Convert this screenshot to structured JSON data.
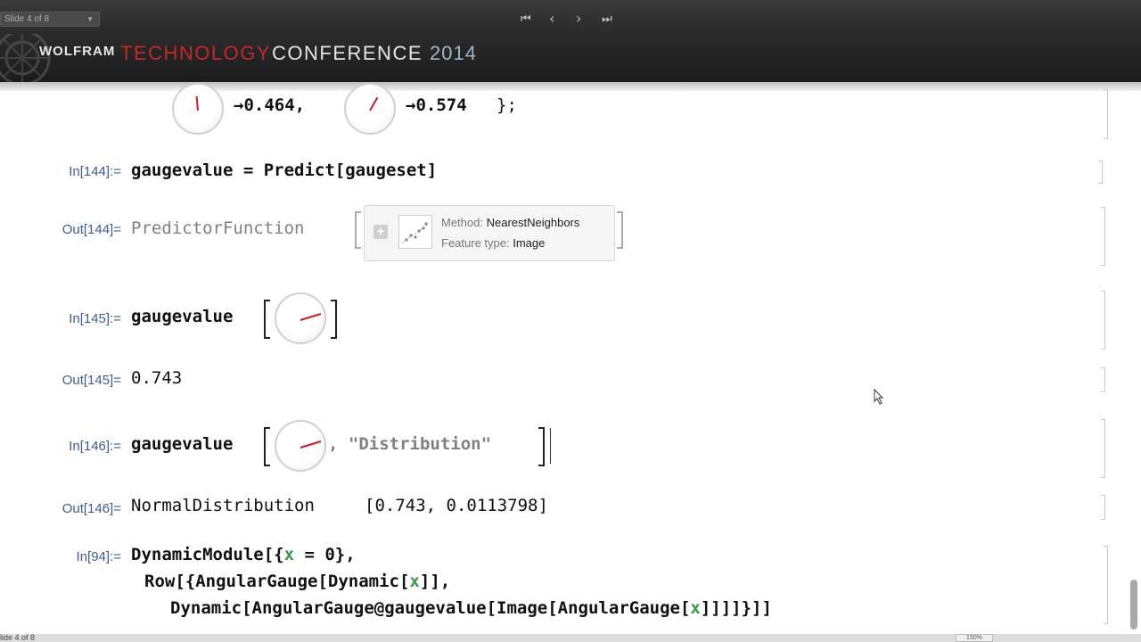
{
  "toolbar": {
    "slide_selector": "Slide 4 of 8",
    "nav": {
      "first": "⏮",
      "prev": "‹",
      "next": "›",
      "last": "⏭"
    }
  },
  "banner": {
    "brand": "WOLFRAM",
    "technology": "TECHNOLOGY",
    "conference": "CONFERENCE",
    "year": "2014"
  },
  "notebook": {
    "top_row": {
      "val1": "→0.464,",
      "val2": "→0.574",
      "close": "};"
    },
    "cells": {
      "in144": {
        "label": "In[144]:=",
        "code": "gaugevalue = Predict[gaugeset]"
      },
      "out144": {
        "label": "Out[144]=",
        "head": "PredictorFunction",
        "method_key": "Method:",
        "method_val": "NearestNeighbors",
        "feature_key": "Feature type:",
        "feature_val": "Image"
      },
      "in145": {
        "label": "In[145]:=",
        "code": "gaugevalue"
      },
      "out145": {
        "label": "Out[145]=",
        "value": "0.743"
      },
      "in146": {
        "label": "In[146]:=",
        "code": "gaugevalue",
        "arg": ", \"Distribution\""
      },
      "out146": {
        "label": "Out[146]=",
        "head": "NormalDistribution",
        "args": "[0.743, 0.0113798]"
      },
      "in94": {
        "label": "In[94]:=",
        "line1a": "DynamicModule[{",
        "line1x": "x",
        "line1b": " = 0},",
        "line2a": "Row[{AngularGauge[Dynamic[",
        "line2x": "x",
        "line2b": "]],",
        "line3a": "Dynamic[AngularGauge@gaugevalue[Image[AngularGauge[",
        "line3x": "x",
        "line3b": "]]]]}]]"
      }
    }
  },
  "status": {
    "slide": "lide 4 of 8",
    "zoom": "150%"
  },
  "colors": {
    "accent_red": "#c4282b",
    "label_blue": "#3e5b97",
    "var_green": "#3b9a4a"
  }
}
